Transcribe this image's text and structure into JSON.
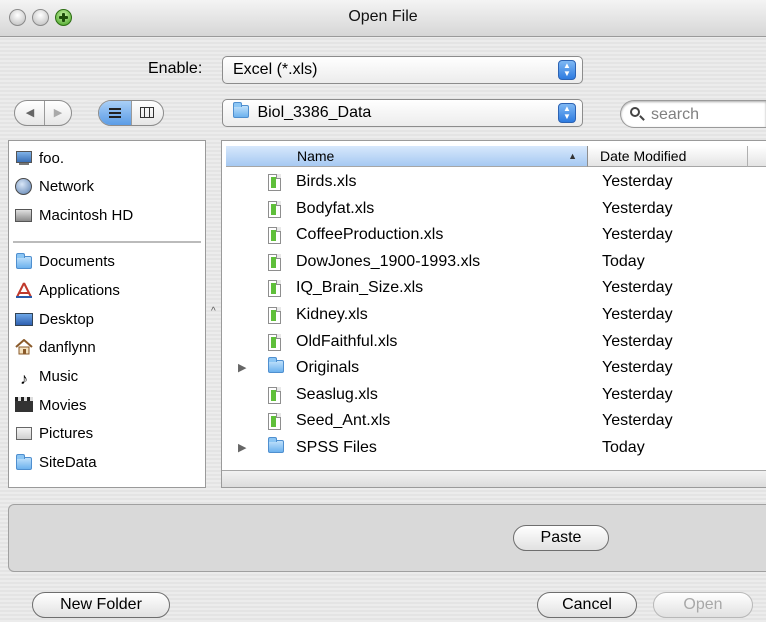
{
  "window": {
    "title": "Open File"
  },
  "enable": {
    "label": "Enable:",
    "value": "Excel (*.xls)"
  },
  "location": {
    "value": "Biol_3386_Data"
  },
  "search": {
    "placeholder": "search"
  },
  "sidebar": {
    "devices": [
      {
        "label": "foo.",
        "icon": "computer-icon"
      },
      {
        "label": "Network",
        "icon": "network-icon"
      },
      {
        "label": "Macintosh HD",
        "icon": "hard-drive-icon"
      }
    ],
    "places": [
      {
        "label": "Documents",
        "icon": "folder-icon"
      },
      {
        "label": "Applications",
        "icon": "applications-icon"
      },
      {
        "label": "Desktop",
        "icon": "desktop-icon"
      },
      {
        "label": "danflynn",
        "icon": "home-icon"
      },
      {
        "label": "Music",
        "icon": "music-icon"
      },
      {
        "label": "Movies",
        "icon": "movies-icon"
      },
      {
        "label": "Pictures",
        "icon": "pictures-icon"
      },
      {
        "label": "SiteData",
        "icon": "folder-icon"
      }
    ]
  },
  "browser": {
    "columns": {
      "name": "Name",
      "date": "Date Modified"
    },
    "files": [
      {
        "name": "Birds.xls",
        "date": "Yesterday",
        "kind": "file"
      },
      {
        "name": "Bodyfat.xls",
        "date": "Yesterday",
        "kind": "file"
      },
      {
        "name": "CoffeeProduction.xls",
        "date": "Yesterday",
        "kind": "file"
      },
      {
        "name": "DowJones_1900-1993.xls",
        "date": "Today",
        "kind": "file"
      },
      {
        "name": "IQ_Brain_Size.xls",
        "date": "Yesterday",
        "kind": "file"
      },
      {
        "name": "Kidney.xls",
        "date": "Yesterday",
        "kind": "file"
      },
      {
        "name": "OldFaithful.xls",
        "date": "Yesterday",
        "kind": "file"
      },
      {
        "name": "Originals",
        "date": "Yesterday",
        "kind": "folder"
      },
      {
        "name": "Seaslug.xls",
        "date": "Yesterday",
        "kind": "file"
      },
      {
        "name": "Seed_Ant.xls",
        "date": "Yesterday",
        "kind": "file"
      },
      {
        "name": "SPSS Files",
        "date": "Today",
        "kind": "folder"
      }
    ]
  },
  "buttons": {
    "paste": "Paste",
    "new_folder": "New Folder",
    "cancel": "Cancel",
    "open": "Open"
  }
}
